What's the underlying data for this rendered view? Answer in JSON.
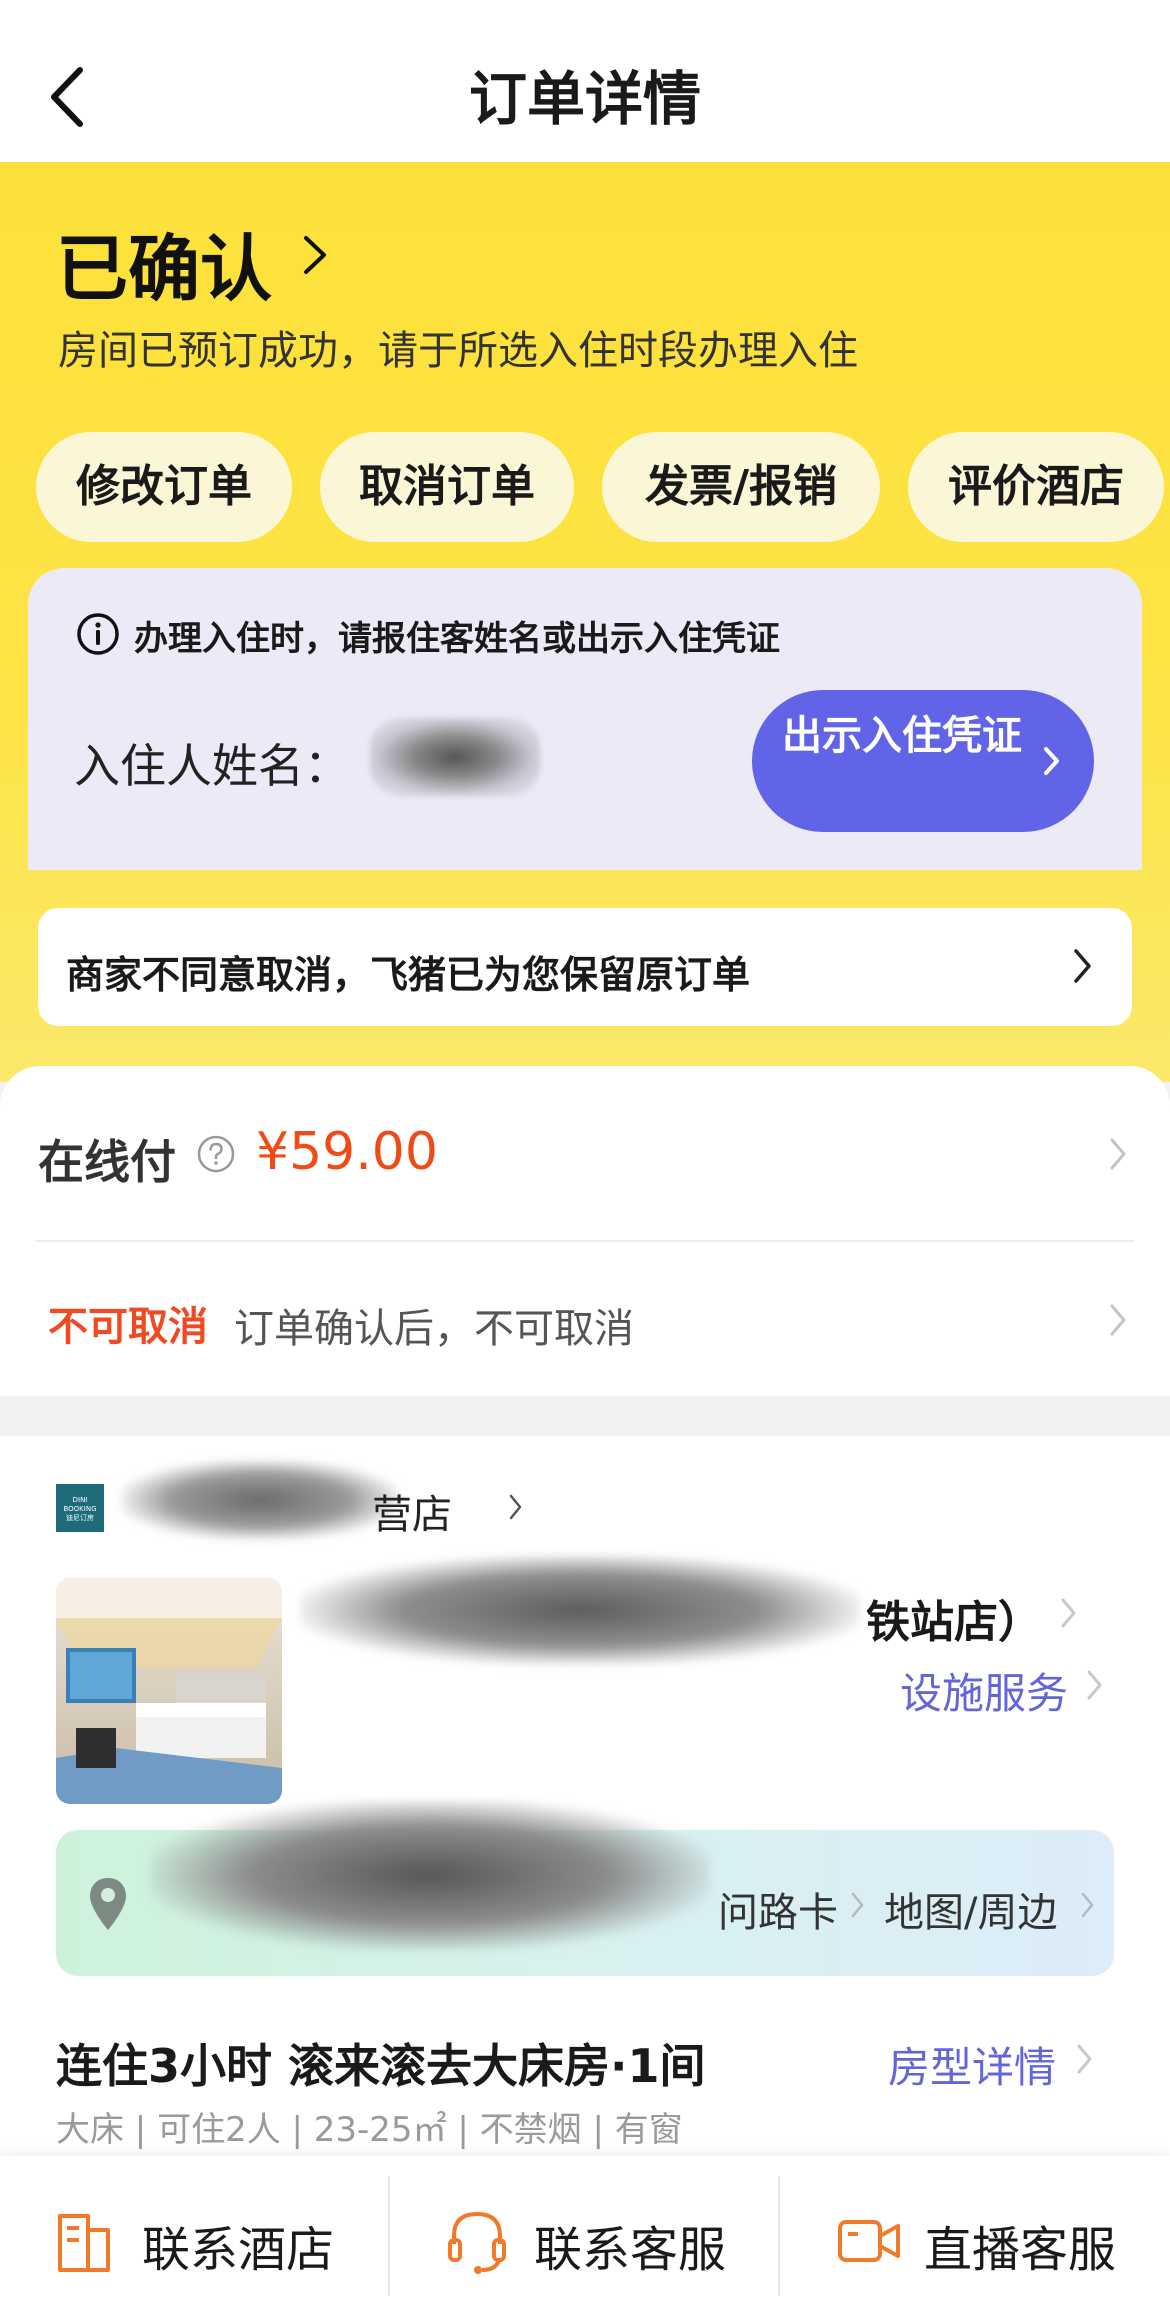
{
  "header": {
    "title": "订单详情"
  },
  "status": {
    "title": "已确认",
    "description": "房间已预订成功，请于所选入住时段办理入住"
  },
  "actions": [
    "修改订单",
    "取消订单",
    "发票/报销",
    "评价酒店"
  ],
  "checkin": {
    "tip": "办理入住时，请报住客姓名或出示入住凭证",
    "guest_label": "入住人姓名：",
    "voucher_button": "出示入住凭证"
  },
  "notice": {
    "text": "商家不同意取消，飞猪已为您保留原订单"
  },
  "payment": {
    "label": "在线付",
    "amount": "¥59.00",
    "cancel_tag": "不可取消",
    "cancel_desc": "订单确认后，不可取消"
  },
  "hotel": {
    "brand_logo_text": "DINI BOOKING 迪尼订房",
    "brand_name_visible": "营店",
    "name_visible": "铁站店）",
    "facility_link": "设施服务",
    "route_card": "问路卡",
    "map_link": "地图/周边"
  },
  "room": {
    "title": "连住3小时 滚来滚去大床房·1间",
    "detail_link": "房型详情",
    "specs": "大床 | 可住2人 | 23-25㎡ | 不禁烟 | 有窗"
  },
  "bottom_bar": {
    "contact_hotel": "联系酒店",
    "contact_service": "联系客服",
    "live_service": "直播客服"
  },
  "colors": {
    "header_bg": "#ffffff",
    "status_bg": "#fde13a",
    "accent_purple": "#6164e6",
    "price_red": "#f04a16",
    "cancel_red": "#ef4a22",
    "link_purple": "#6366d6",
    "icon_orange": "#f07a2a"
  }
}
